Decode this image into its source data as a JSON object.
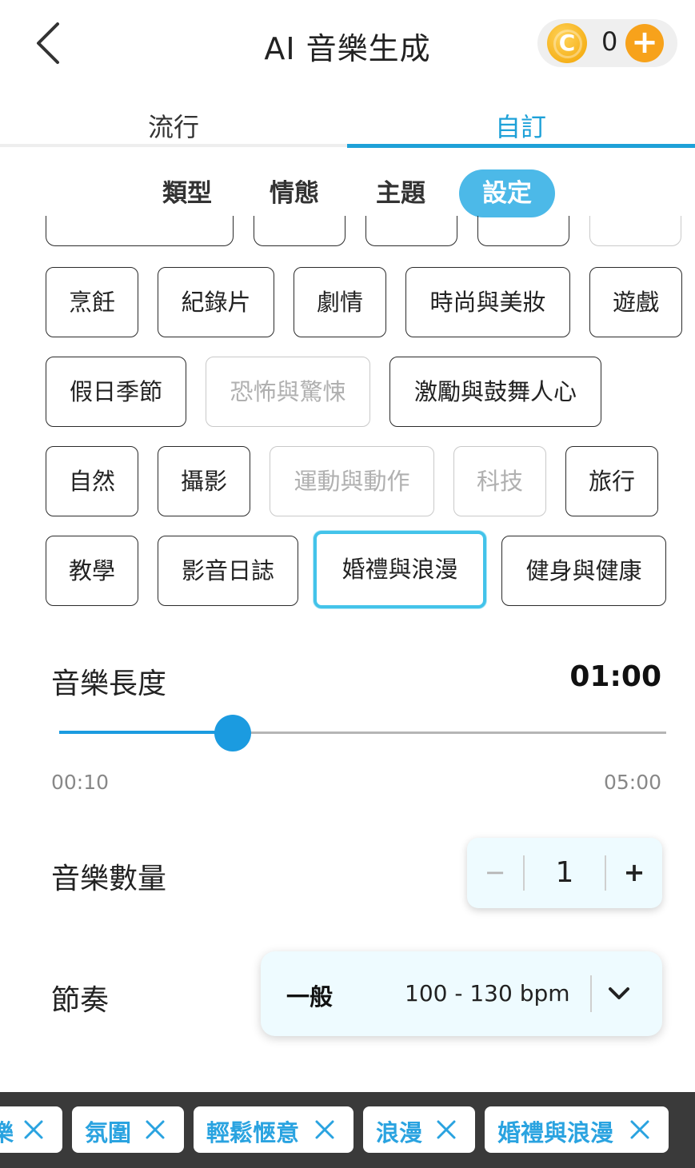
{
  "header": {
    "title": "AI 音樂生成",
    "coin_letter": "C",
    "coin_count": "0",
    "add_label": "+"
  },
  "main_tabs": [
    {
      "label": "流行",
      "active": false
    },
    {
      "label": "自訂",
      "active": true
    }
  ],
  "sub_tabs": [
    {
      "label": "類型",
      "active": false
    },
    {
      "label": "情態",
      "active": false
    },
    {
      "label": "主題",
      "active": false
    },
    {
      "label": "設定",
      "active": true
    }
  ],
  "theme_chips": [
    {
      "label": "烹飪",
      "state": "normal"
    },
    {
      "label": "紀錄片",
      "state": "normal"
    },
    {
      "label": "劇情",
      "state": "normal"
    },
    {
      "label": "時尚與美妝",
      "state": "normal"
    },
    {
      "label": "遊戲",
      "state": "normal"
    },
    {
      "label": "假日季節",
      "state": "normal"
    },
    {
      "label": "恐怖與驚悚",
      "state": "disabled"
    },
    {
      "label": "激勵與鼓舞人心",
      "state": "normal"
    },
    {
      "label": "自然",
      "state": "normal"
    },
    {
      "label": "攝影",
      "state": "normal"
    },
    {
      "label": "運動與動作",
      "state": "disabled"
    },
    {
      "label": "科技",
      "state": "disabled"
    },
    {
      "label": "旅行",
      "state": "normal"
    },
    {
      "label": "教學",
      "state": "normal"
    },
    {
      "label": "影音日誌",
      "state": "normal"
    },
    {
      "label": "婚禮與浪漫",
      "state": "selected"
    },
    {
      "label": "健身與健康",
      "state": "normal"
    }
  ],
  "length": {
    "label": "音樂長度",
    "value": "01:00",
    "min_label": "00:10",
    "max_label": "05:00",
    "min_seconds": 10,
    "max_seconds": 300,
    "current_seconds": 60
  },
  "quantity": {
    "label": "音樂數量",
    "minus": "−",
    "value": "1",
    "plus": "+"
  },
  "tempo": {
    "label": "節奏",
    "selected_name": "一般",
    "selected_bpm": "100 - 130 bpm"
  },
  "selected_tags": [
    {
      "label": "樂"
    },
    {
      "label": "氛圍"
    },
    {
      "label": "輕鬆愜意"
    },
    {
      "label": "浪漫"
    },
    {
      "label": "婚禮與浪漫"
    }
  ],
  "colors": {
    "accent": "#1ea1d8",
    "sub_tab_active": "#4cb9e8",
    "slider": "#1b9be0",
    "coin": "#f2a300",
    "add_button": "#f7a21b",
    "tag_text": "#2aa3e0"
  }
}
